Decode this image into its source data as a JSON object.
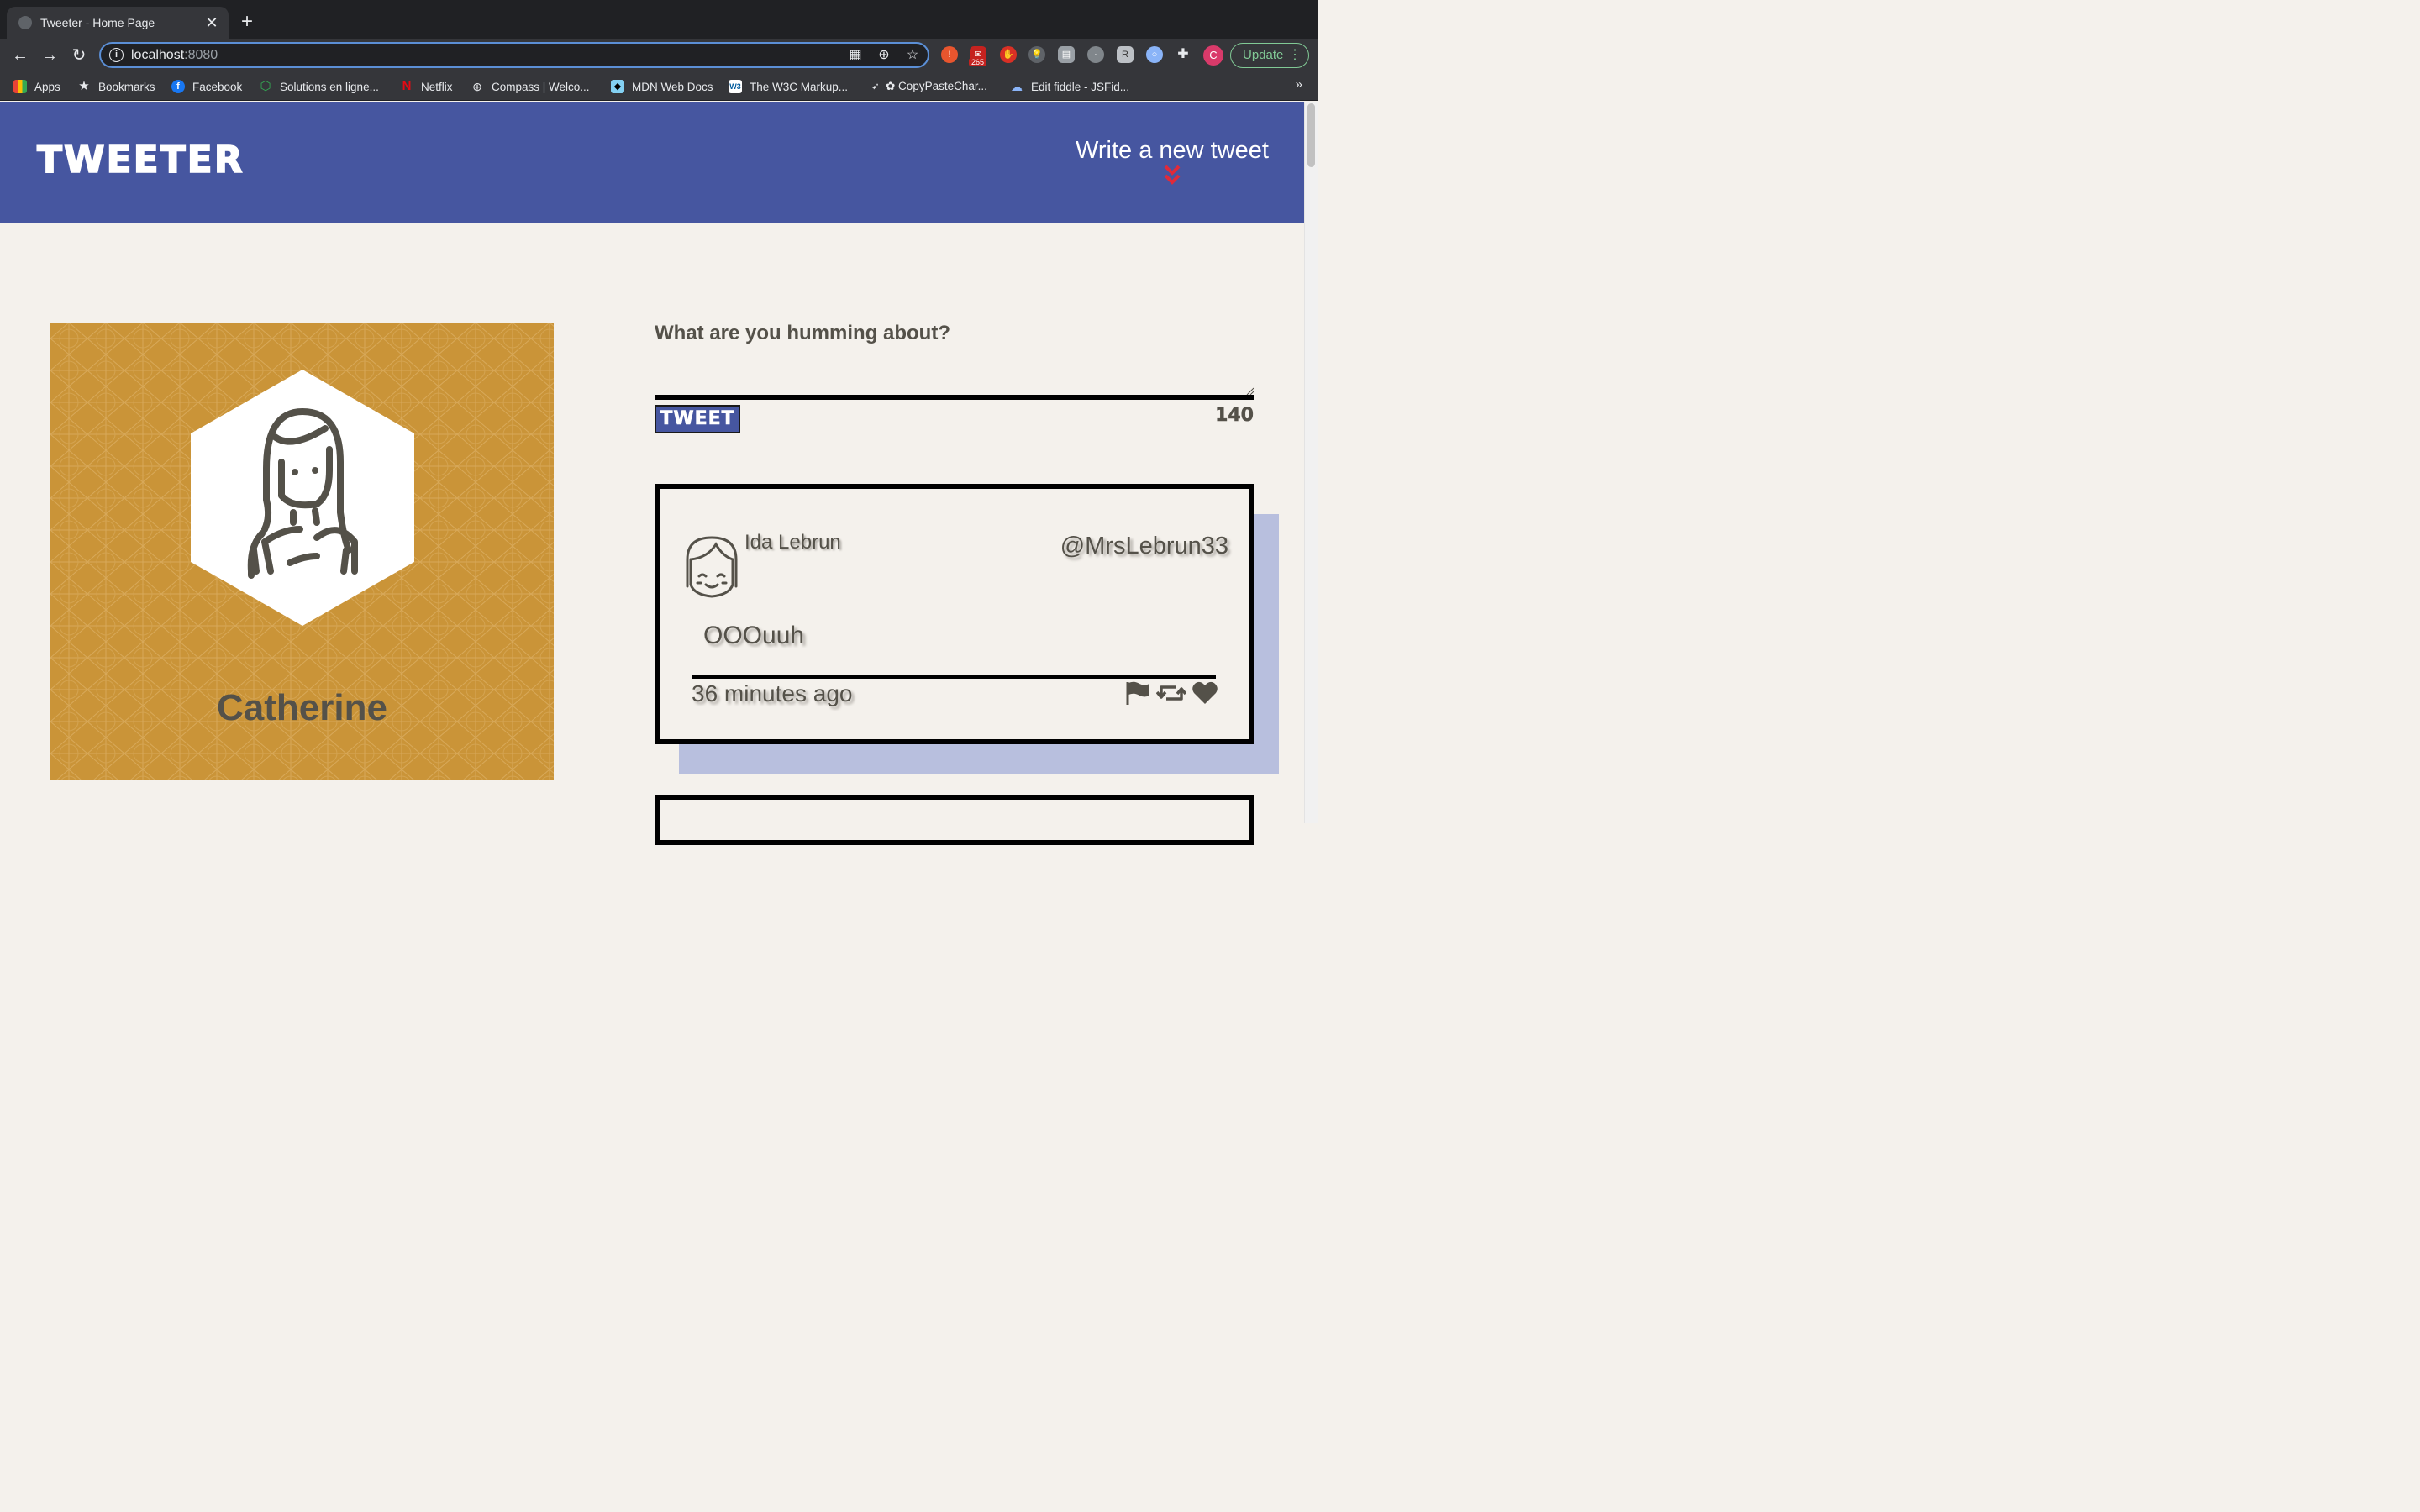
{
  "browser": {
    "tab_title": "Tweeter - Home Page",
    "tab_close": "✕",
    "new_tab": "+",
    "url_host": "localhost",
    "url_port": ":8080",
    "update_label": "Update",
    "profile_initial": "C",
    "mail_badge": "265",
    "bookmarks": [
      {
        "label": "Apps",
        "icon": "apps-grid-icon"
      },
      {
        "label": "Bookmarks",
        "icon": "star-icon"
      },
      {
        "label": "Facebook",
        "icon": "facebook-icon"
      },
      {
        "label": "Solutions en ligne...",
        "icon": "hexagon-icon"
      },
      {
        "label": "Netflix",
        "icon": "netflix-icon"
      },
      {
        "label": "Compass | Welco...",
        "icon": "compass-icon"
      },
      {
        "label": "MDN Web Docs",
        "icon": "mdn-icon"
      },
      {
        "label": "The W3C Markup...",
        "icon": "w3c-icon"
      },
      {
        "label": "✿ CopyPasteChar...",
        "icon": "cursor-icon"
      },
      {
        "label": "Edit fiddle - JSFid...",
        "icon": "cloud-icon"
      }
    ],
    "bookmarks_more": "»"
  },
  "header": {
    "logo": "TWEETER",
    "write_link": "Write a new tweet"
  },
  "profile": {
    "name": "Catherine"
  },
  "compose": {
    "label": "What are you humming about?",
    "value": "",
    "button": "TWEET",
    "counter": "140"
  },
  "tweets": [
    {
      "name": "Ida Lebrun",
      "handle": "@MrsLebrun33",
      "content": "OOOuuh",
      "time": "36 minutes ago"
    }
  ],
  "colors": {
    "header_bg": "#4656a0",
    "page_bg": "#f4f1ec",
    "profile_bg": "#ca9438",
    "text": "#545149",
    "accent": "#e02a3a",
    "tweet_shadow": "#b8bfde"
  }
}
